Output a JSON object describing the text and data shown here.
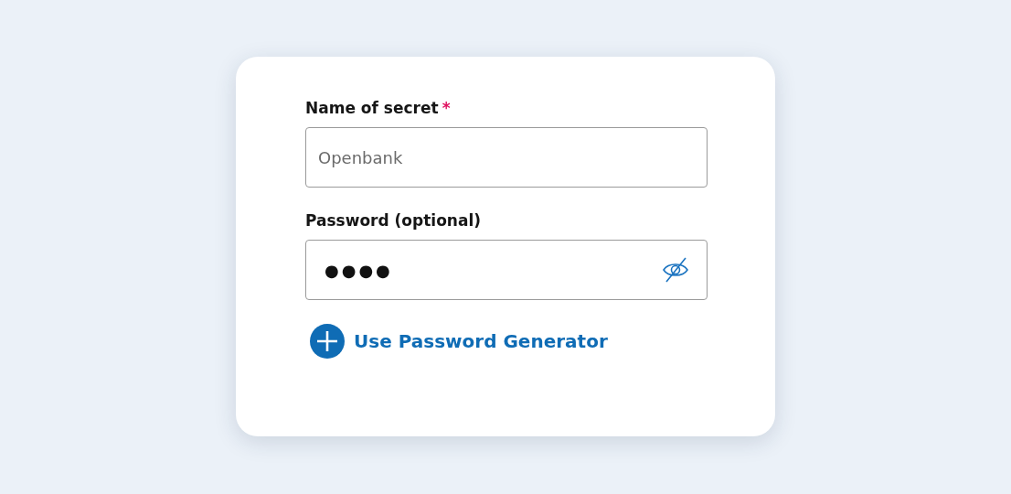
{
  "fields": [
    {
      "label": "Name of secret",
      "required_mark": "*",
      "placeholder": "Openbank",
      "kind": "text"
    },
    {
      "label": "Password (optional)",
      "value": "●●●●",
      "kind": "password",
      "revealed": false
    }
  ],
  "generator_link": {
    "label": "Use Password Generator"
  }
}
